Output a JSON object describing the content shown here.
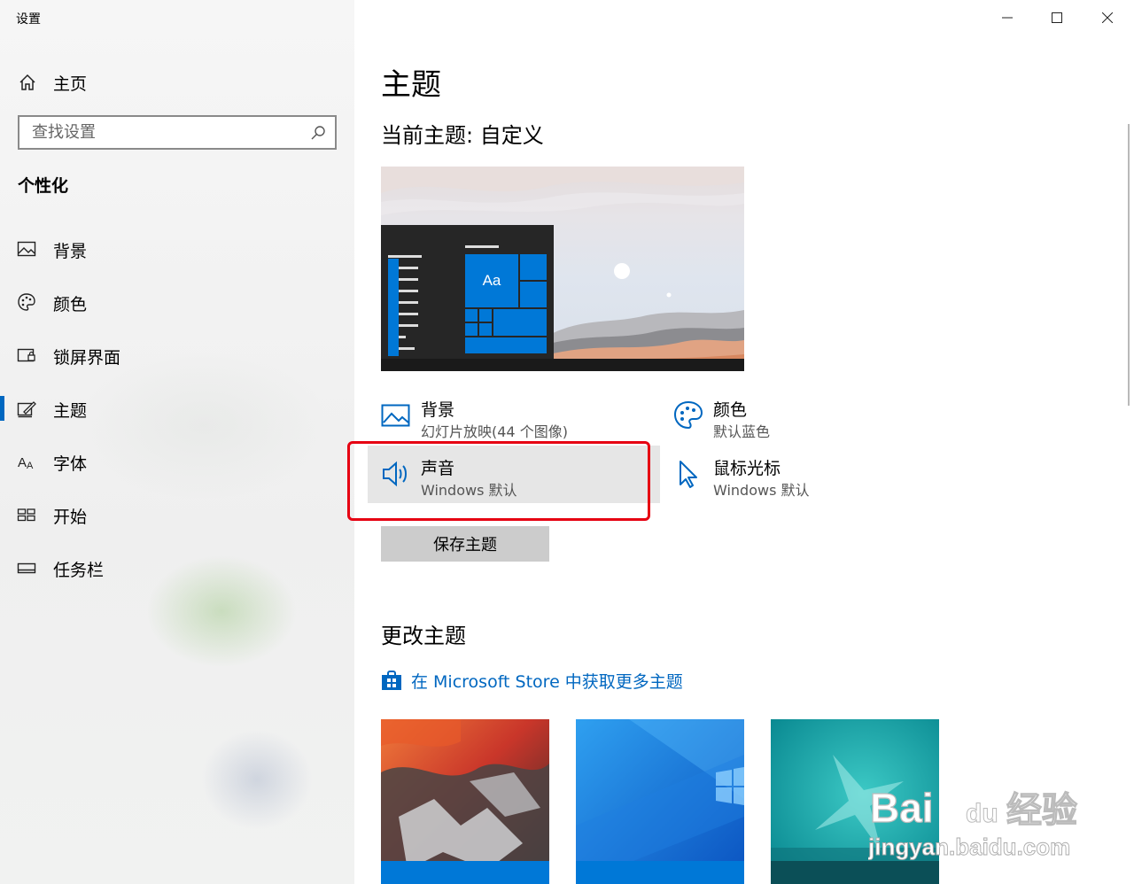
{
  "window": {
    "title": "设置"
  },
  "sidebar": {
    "home_label": "主页",
    "search_placeholder": "查找设置",
    "section_label": "个性化",
    "items": [
      {
        "label": "背景",
        "icon": "picture-icon"
      },
      {
        "label": "颜色",
        "icon": "palette-icon"
      },
      {
        "label": "锁屏界面",
        "icon": "lock-screen-icon"
      },
      {
        "label": "主题",
        "icon": "theme-icon",
        "active": true
      },
      {
        "label": "字体",
        "icon": "font-icon"
      },
      {
        "label": "开始",
        "icon": "start-icon"
      },
      {
        "label": "任务栏",
        "icon": "taskbar-icon"
      }
    ]
  },
  "main": {
    "page_title": "主题",
    "current_theme": "当前主题: 自定义",
    "preview_tile_text": "Aa",
    "settings": [
      {
        "name": "背景",
        "sub": "幻灯片放映(44 个图像)",
        "icon": "picture-icon"
      },
      {
        "name": "颜色",
        "sub": "默认蓝色",
        "icon": "palette-icon"
      },
      {
        "name": "声音",
        "sub": "Windows 默认",
        "icon": "speaker-icon",
        "highlighted": true
      },
      {
        "name": "鼠标光标",
        "sub": "Windows 默认",
        "icon": "cursor-icon"
      }
    ],
    "save_button": "保存主题",
    "change_title": "更改主题",
    "store_link": "在 Microsoft Store 中获取更多主题"
  },
  "watermark": {
    "line1": "Bai",
    "line1b": "du",
    "line1c": "经验",
    "line2": "jingyan.baidu.com"
  },
  "colors": {
    "accent": "#0067c0",
    "highlight_frame": "#e60012",
    "tile_blue": "#0078d7"
  }
}
